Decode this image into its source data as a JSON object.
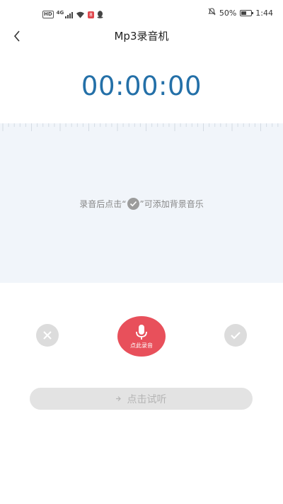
{
  "status_bar": {
    "hd": "HD",
    "network": "4G",
    "carrier_badge": "8",
    "battery_text": "50%",
    "battery_level": 0.5,
    "time": "1:44"
  },
  "header": {
    "title": "Mp3录音机"
  },
  "timer": {
    "value": "00:00:00"
  },
  "recording_area": {
    "hint_before": "录音后点击“",
    "hint_after": "”可添加背景音乐"
  },
  "controls": {
    "record_label": "点此录音"
  },
  "playback": {
    "label": "点击试听"
  },
  "colors": {
    "accent": "#2470a8",
    "record": "#e8505b",
    "panel_bg": "#f1f5fa"
  }
}
